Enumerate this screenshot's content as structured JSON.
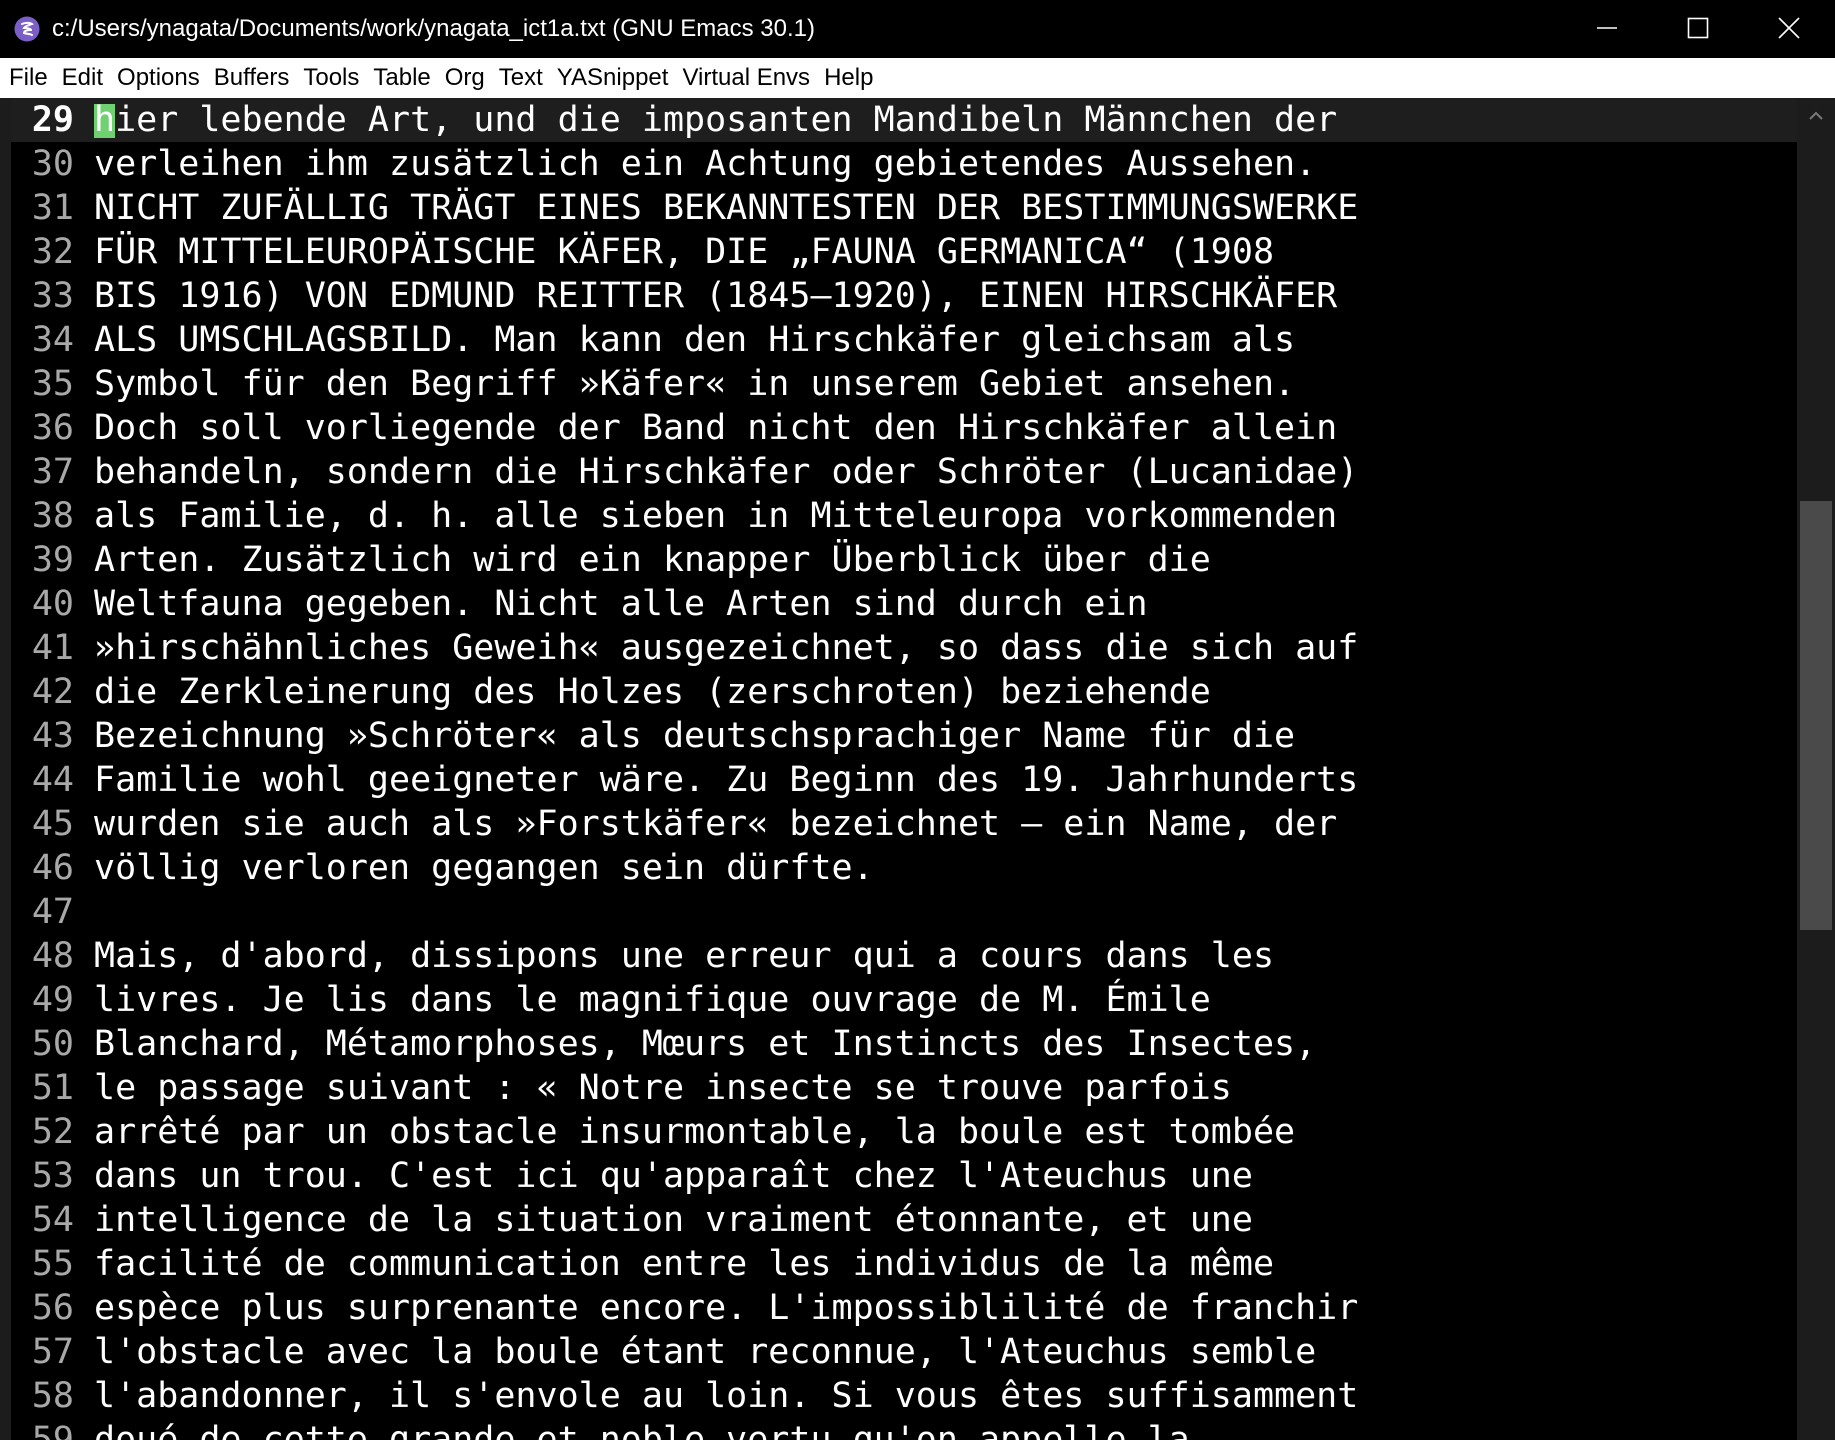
{
  "window": {
    "title": "c:/Users/ynagata/Documents/work/ynagata_ict1a.txt (GNU Emacs 30.1)",
    "app_icon": "emacs-icon",
    "controls": [
      "minimize-icon",
      "maximize-icon",
      "close-icon"
    ]
  },
  "menubar": {
    "items": [
      "File",
      "Edit",
      "Options",
      "Buffers",
      "Tools",
      "Table",
      "Org",
      "Text",
      "YASnippet",
      "Virtual Envs",
      "Help"
    ]
  },
  "editor": {
    "current_line": "29",
    "cursor_color": "#6fd16f",
    "lines": [
      {
        "n": "29",
        "text": "hier lebende Art, und die imposanten Mandibeln Männchen der"
      },
      {
        "n": "30",
        "text": "verleihen ihm zusätzlich ein Achtung gebietendes Aussehen."
      },
      {
        "n": "31",
        "text": "NICHT ZUFÄLLIG TRÄGT EINES BEKANNTESTEN DER BESTIMMUNGSWERKE"
      },
      {
        "n": "32",
        "text": "FÜR MITTELEUROPÄISCHE KÄFER, DIE „FAUNA GERMANICA“ (1908"
      },
      {
        "n": "33",
        "text": "BIS 1916) VON EDMUND REITTER (1845–1920), EINEN HIRSCHKÄFER"
      },
      {
        "n": "34",
        "text": "ALS UMSCHLAGSBILD. Man kann den Hirschkäfer gleichsam als"
      },
      {
        "n": "35",
        "text": "Symbol für den Begriff »Käfer« in unserem Gebiet ansehen."
      },
      {
        "n": "36",
        "text": "Doch soll vorliegende der Band nicht den Hirschkäfer allein"
      },
      {
        "n": "37",
        "text": "behandeln, sondern die Hirschkäfer oder Schröter (Lucanidae)"
      },
      {
        "n": "38",
        "text": "als Familie, d. h. alle sieben in Mitteleuropa vorkommenden"
      },
      {
        "n": "39",
        "text": "Arten. Zusätzlich wird ein knapper Überblick über die"
      },
      {
        "n": "40",
        "text": "Weltfauna gegeben. Nicht alle Arten sind durch ein"
      },
      {
        "n": "41",
        "text": "»hirschähnliches Geweih« ausgezeichnet, so dass die sich auf"
      },
      {
        "n": "42",
        "text": "die Zerkleinerung des Holzes (zerschroten) beziehende"
      },
      {
        "n": "43",
        "text": "Bezeichnung »Schröter« als deutschsprachiger Name für die"
      },
      {
        "n": "44",
        "text": "Familie wohl geeigneter wäre. Zu Beginn des 19. Jahrhunderts"
      },
      {
        "n": "45",
        "text": "wurden sie auch als »Forstkäfer« bezeichnet – ein Name, der"
      },
      {
        "n": "46",
        "text": "völlig verloren gegangen sein dürfte."
      },
      {
        "n": "47",
        "text": ""
      },
      {
        "n": "48",
        "text": "Mais, d'abord, dissipons une erreur qui a cours dans les"
      },
      {
        "n": "49",
        "text": "livres. Je lis dans le magnifique ouvrage de M. Émile"
      },
      {
        "n": "50",
        "text": "Blanchard, Métamorphoses, Mœurs et Instincts des Insectes,"
      },
      {
        "n": "51",
        "text": "le passage suivant : « Notre insecte se trouve parfois"
      },
      {
        "n": "52",
        "text": "arrêté par un obstacle insurmontable, la boule est tombée"
      },
      {
        "n": "53",
        "text": "dans un trou. C'est ici qu'apparaît chez l'Ateuchus une"
      },
      {
        "n": "54",
        "text": "intelligence de la situation vraiment étonnante, et une"
      },
      {
        "n": "55",
        "text": "facilité de communication entre les individus de la même"
      },
      {
        "n": "56",
        "text": "espèce plus surprenante encore. L'impossiblilité de franchir"
      },
      {
        "n": "57",
        "text": "l'obstacle avec la boule étant reconnue, l'Ateuchus semble"
      },
      {
        "n": "58",
        "text": "l'abandonner, il s'envole au loin. Si vous êtes suffisamment"
      },
      {
        "n": "59",
        "text": "doué de cette grande et noble vertu qu'on appelle la"
      }
    ]
  },
  "scrollbar": {
    "up_icon": "chevron-up-icon",
    "thumb_start_fraction": 0.3,
    "thumb_size_fraction": 0.32
  }
}
